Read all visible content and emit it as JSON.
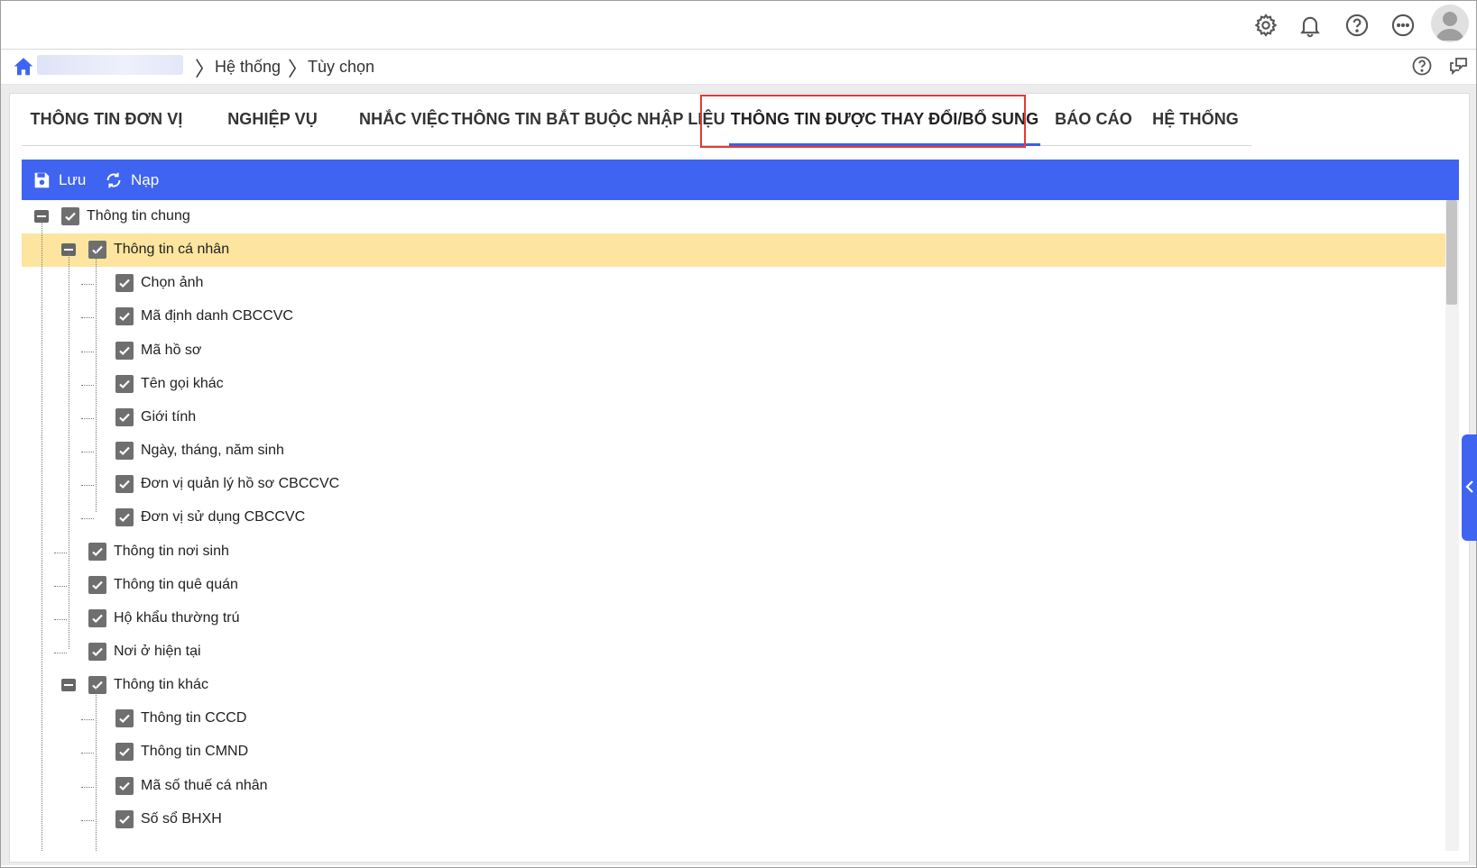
{
  "topbar": {
    "icons": [
      "settings-icon",
      "bell-icon",
      "help-icon",
      "more-icon",
      "avatar-icon"
    ]
  },
  "breadcrumb": {
    "items": [
      "Hệ thống",
      "Tùy chọn"
    ]
  },
  "tabs": [
    {
      "label": "THÔNG TIN ĐƠN VỊ",
      "active": false
    },
    {
      "label": "NGHIỆP VỤ",
      "active": false
    },
    {
      "label": "NHẮC VIỆC",
      "active": false
    },
    {
      "label": "THÔNG TIN BẮT BUỘC NHẬP LIỆU",
      "active": false
    },
    {
      "label": "THÔNG TIN ĐƯỢC THAY ĐỔI/BỔ SUNG",
      "active": true
    },
    {
      "label": "BÁO CÁO",
      "active": false
    },
    {
      "label": "HỆ THỐNG",
      "active": false
    }
  ],
  "toolbar": {
    "save_label": "Lưu",
    "reload_label": "Nạp"
  },
  "tree": [
    {
      "label": "Thông tin chung",
      "level": 0,
      "expanded": true,
      "checked": true
    },
    {
      "label": "Thông tin cá nhân",
      "level": 1,
      "expanded": true,
      "checked": true,
      "selected": true
    },
    {
      "label": "Chọn ảnh",
      "level": 2,
      "checked": true
    },
    {
      "label": "Mã định danh CBCCVC",
      "level": 2,
      "checked": true
    },
    {
      "label": "Mã hồ sơ",
      "level": 2,
      "checked": true
    },
    {
      "label": "Tên gọi khác",
      "level": 2,
      "checked": true
    },
    {
      "label": "Giới tính",
      "level": 2,
      "checked": true
    },
    {
      "label": "Ngày, tháng, năm sinh",
      "level": 2,
      "checked": true
    },
    {
      "label": "Đơn vị quản lý hồ sơ CBCCVC",
      "level": 2,
      "checked": true
    },
    {
      "label": "Đơn vị sử dụng CBCCVC",
      "level": 2,
      "checked": true
    },
    {
      "label": "Thông tin nơi sinh",
      "level": 1,
      "checked": true
    },
    {
      "label": "Thông tin quê quán",
      "level": 1,
      "checked": true
    },
    {
      "label": "Hộ khẩu thường trú",
      "level": 1,
      "checked": true
    },
    {
      "label": "Nơi ở hiện tại",
      "level": 1,
      "checked": true
    },
    {
      "label": "Thông tin khác",
      "level": 1,
      "expanded": true,
      "checked": true
    },
    {
      "label": "Thông tin CCCD",
      "level": 2,
      "checked": true
    },
    {
      "label": "Thông tin CMND",
      "level": 2,
      "checked": true
    },
    {
      "label": "Mã số thuế cá nhân",
      "level": 2,
      "checked": true
    },
    {
      "label": "Số sổ BHXH",
      "level": 2,
      "checked": true
    }
  ],
  "colors": {
    "accent": "#3f64f2",
    "selected_row": "#fde59f",
    "highlight_border": "#e53935"
  }
}
